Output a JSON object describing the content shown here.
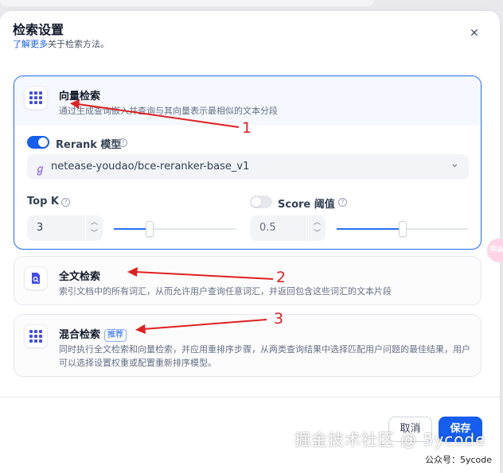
{
  "header": {
    "title": "检索设置",
    "learn_more": "了解更多",
    "learn_more_suffix": "关于检索方法。"
  },
  "methods": [
    {
      "name": "向量检索",
      "description": "通过生成查询嵌入并查询与其向量表示最相似的文本分段",
      "icon": "grid-dots-icon",
      "selected": true
    },
    {
      "name": "全文检索",
      "description": "索引文档中的所有词汇，从而允许用户查询任意词汇，并返回包含这些词汇的文本片段",
      "icon": "document-search-icon",
      "selected": false
    },
    {
      "name": "混合检索",
      "badge": "推荐",
      "description": "同时执行全文检索和向量检索，并应用重排序步骤，从两类查询结果中选择匹配用户问题的最佳结果，用户可以选择设置权重或配置重新排序模型。",
      "icon": "grid-dots-icon",
      "selected": false
    }
  ],
  "rerank": {
    "label": "Rerank 模型",
    "enabled": true,
    "model": "netease-youdao/bce-reranker-base_v1"
  },
  "top_k": {
    "label": "Top K",
    "value": "3",
    "slider_fraction": 0.29
  },
  "score_threshold": {
    "label": "Score 阈值",
    "enabled": false,
    "value": "0.5",
    "slider_fraction": 0.5
  },
  "footer": {
    "cancel": "取消",
    "save": "保存"
  },
  "annotations": [
    "1",
    "2",
    "3"
  ],
  "watermark": {
    "main": "掘金技术社区 @ 5ycode",
    "sub": "公众号：5ycode"
  },
  "side_badge": "中A",
  "colors": {
    "primary": "#155eef",
    "arrow": "#e02020"
  }
}
